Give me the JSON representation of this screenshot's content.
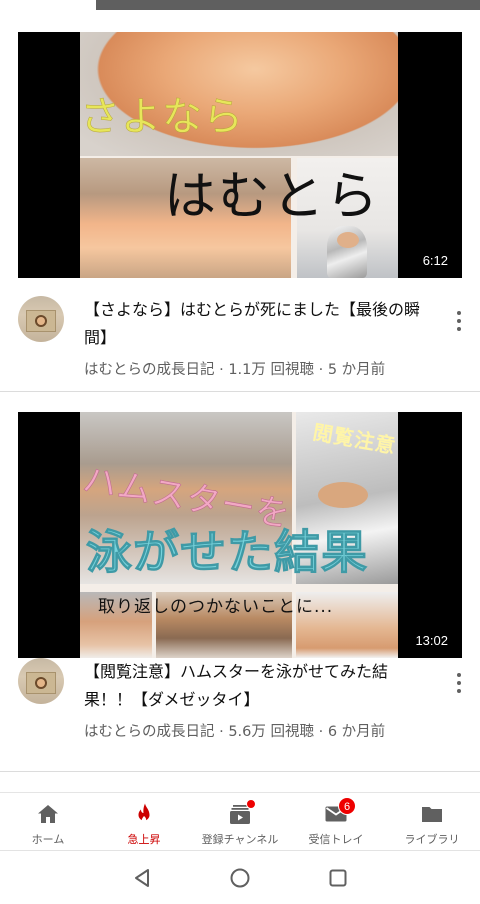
{
  "status": {
    "loading_progress": 0.2
  },
  "videos": [
    {
      "thumb_caption_1": "さよなら",
      "thumb_caption_2": "はむとら",
      "duration": "6:12",
      "title": "【さよなら】はむとらが死にました【最後の瞬間】",
      "channel": "はむとらの成長日記",
      "views": "1.1万 回視聴",
      "age": "5 か月前",
      "meta_line": "はむとらの成長日記 · 1.1万 回視聴 · 5 か月前"
    },
    {
      "thumb_caption_1": "ハムスターを",
      "thumb_caption_2": "泳がせた結果",
      "thumb_caption_3": "取り返しのつかないことに...",
      "thumb_caption_4": "閲覧注意",
      "duration": "13:02",
      "title": "【閲覧注意】ハムスターを泳がせてみた結果！！【ダメゼッタイ】",
      "channel": "はむとらの成長日記",
      "views": "5.6万 回視聴",
      "age": "6 か月前",
      "meta_line": "はむとらの成長日記 · 5.6万 回視聴 · 6 か月前"
    }
  ],
  "bottom_nav": [
    {
      "label": "ホーム",
      "icon": "home-icon",
      "active": false
    },
    {
      "label": "急上昇",
      "icon": "flame-icon",
      "active": true
    },
    {
      "label": "登録チャンネル",
      "icon": "subscriptions-icon",
      "active": false,
      "dot": true
    },
    {
      "label": "受信トレイ",
      "icon": "inbox-icon",
      "active": false,
      "badge": "6"
    },
    {
      "label": "ライブラリ",
      "icon": "folder-icon",
      "active": false
    }
  ],
  "colors": {
    "active": "#cc0000",
    "text_secondary": "#606060",
    "badge": "#ee0000"
  },
  "system_nav": [
    "back-icon",
    "home-circle-icon",
    "recents-icon"
  ]
}
